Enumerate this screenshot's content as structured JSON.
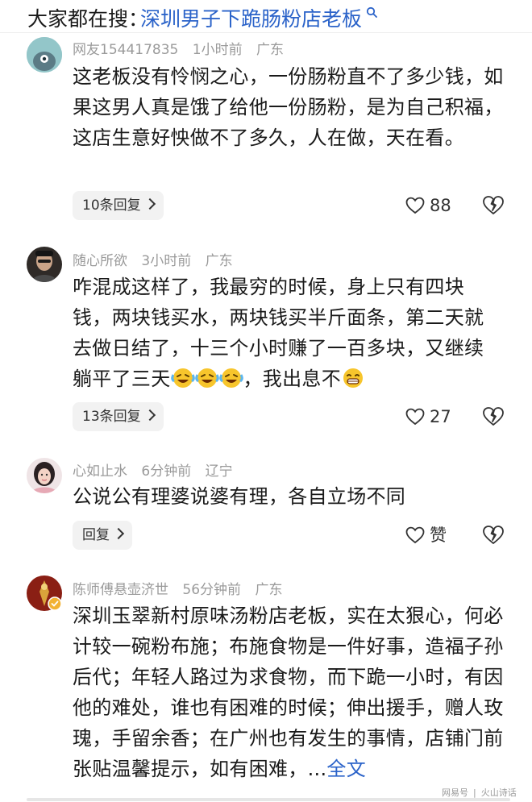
{
  "search": {
    "prefix": "大家都在搜：",
    "query": "深圳男子下跪肠粉店老板"
  },
  "comments": [
    {
      "user": "网友154417835",
      "time": "1小时前",
      "location": "广东",
      "text": "这老板没有怜悯之心，一份肠粉直不了多少钱，如果这男人真是饿了给他一份肠粉，是为自己积福，这店生意好怏做不了多久，人在做，天在看。",
      "reply_label": "10条回复",
      "likes": "88"
    },
    {
      "user": "随心所欲",
      "time": "3小时前",
      "location": "广东",
      "text_lines": [
        "咋混成这样了，我最穷的时候，身上只有四块",
        "钱，两块钱买水，两块钱买半斤面条，第二天就",
        "去做日结了，十三个小时赚了一百多块，又继续",
        "躺平了三天"
      ],
      "text_tail": "，我出息不",
      "reply_label": "13条回复",
      "likes": "27"
    },
    {
      "user": "心如止水",
      "time": "6分钟前",
      "location": "辽宁",
      "text": "公说公有理婆说婆有理，各自立场不同",
      "reply_label": "回复",
      "likes": "赞"
    },
    {
      "user": "陈师傅悬壶济世",
      "time": "56分钟前",
      "location": "广东",
      "text": "深圳玉翠新村原味汤粉店老板，实在太狠心，何必计较一碗粉布施；布施食物是一件好事，造福子孙后代；年轻人路过为求食物，而下跪一小时，有因他的难处，谁也有困难的时候；伸出援手，赠人玫瑰，手留余香；在广州也有发生的事情，店铺门前张贴温馨提示，如有困难，...",
      "more_label": "全文"
    }
  ],
  "watermark": {
    "left": "网易号",
    "right": "火山诗话"
  },
  "colors": {
    "link": "#2b63c9",
    "meta": "#9a9a9a",
    "reply_bg": "#f2f2f2"
  }
}
